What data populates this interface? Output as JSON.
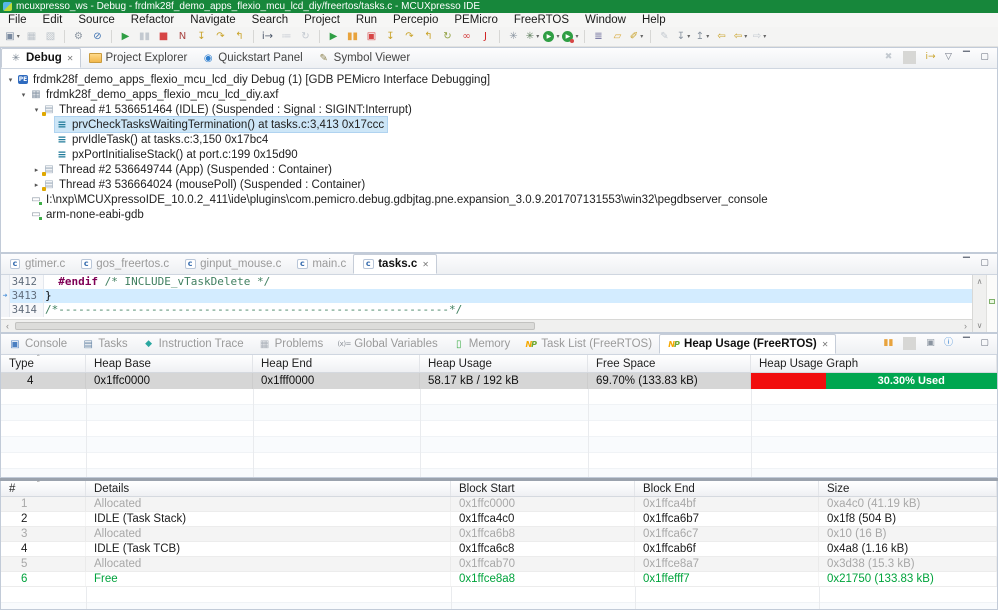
{
  "window": {
    "title": "mcuxpresso_ws - Debug - frdmk28f_demo_apps_flexio_mcu_lcd_diy/freertos/tasks.c - MCUXpresso IDE"
  },
  "colors": {
    "titlebar_green": "#17873b",
    "heap_used_red": "#f10e0e",
    "heap_free_green": "#00a650",
    "selection_blue": "#cde6f7",
    "current_line_blue": "#d3ecff"
  },
  "menu": {
    "items": [
      "File",
      "Edit",
      "Source",
      "Refactor",
      "Navigate",
      "Search",
      "Project",
      "Run",
      "Percepio",
      "PEMicro",
      "FreeRTOS",
      "Window",
      "Help"
    ]
  },
  "toolbar": {
    "icons": [
      {
        "name": "new-wizard-icon",
        "glyph": "▣",
        "color": "#7a8aa0",
        "dd": true
      },
      {
        "name": "save-icon",
        "glyph": "▦",
        "color": "#bcc3ca"
      },
      {
        "name": "save-all-icon",
        "glyph": "▧",
        "color": "#bcc3ca"
      },
      {
        "sep": true,
        "inter": false
      },
      {
        "name": "build-binary-icon",
        "glyph": "⚙",
        "color": "#8a94a0"
      },
      {
        "name": "skip-breakpoints-icon",
        "glyph": "⊘",
        "color": "#3a6fb0"
      },
      {
        "sep": true,
        "inter": false
      },
      {
        "name": "resume-icon",
        "glyph": "▶",
        "color": "#2f9e44"
      },
      {
        "name": "suspend-icon",
        "glyph": "▮▮",
        "color": "#c3c9d0"
      },
      {
        "name": "terminate-icon",
        "glyph": "■",
        "color": "#d64545"
      },
      {
        "name": "disconnect-icon",
        "glyph": "N",
        "color": "#a94442"
      },
      {
        "name": "step-into-icon",
        "glyph": "↧",
        "color": "#c9a227"
      },
      {
        "name": "step-over-icon",
        "glyph": "↷",
        "color": "#c9a227"
      },
      {
        "name": "step-return-icon",
        "glyph": "↰",
        "color": "#c9a227"
      },
      {
        "sep": true,
        "inter": false
      },
      {
        "name": "instruction-stepping-icon",
        "glyph": "i→",
        "color": "#4a5568"
      },
      {
        "name": "show-trace-icon",
        "glyph": "≔",
        "color": "#c3c9d0"
      },
      {
        "name": "trace-options-icon",
        "glyph": "↻",
        "color": "#c3c9d0"
      },
      {
        "sep": true,
        "inter": false
      },
      {
        "name": "resume-all-icon",
        "glyph": "▶",
        "color": "#2f9e44"
      },
      {
        "name": "suspend-all-icon",
        "glyph": "▮▮",
        "color": "#e8a33d"
      },
      {
        "name": "terminate-all-icon",
        "glyph": "▣",
        "color": "#d64545"
      },
      {
        "name": "multi-step-into-icon",
        "glyph": "↧",
        "color": "#c9a227"
      },
      {
        "name": "multi-step-over-icon",
        "glyph": "↷",
        "color": "#c9a227"
      },
      {
        "name": "multi-step-return-icon",
        "glyph": "↰",
        "color": "#c9a227"
      },
      {
        "name": "refresh-icon",
        "glyph": "↻",
        "color": "#8f9f3f"
      },
      {
        "name": "link-debug-icon",
        "glyph": "∞",
        "color": "#d64545"
      },
      {
        "name": "redlink-boot-icon",
        "glyph": "J",
        "color": "#cf1f1f"
      },
      {
        "sep": true,
        "inter": false
      },
      {
        "name": "flash-programmer-icon",
        "glyph": "✳",
        "color": "#8a94a0"
      },
      {
        "name": "debug-icon",
        "glyph": "✳",
        "color": "#5f7f5f",
        "dd": true
      },
      {
        "name": "run-icon",
        "glyph": "▶",
        "color": "#ffffff",
        "bg": "#2f9e44",
        "cls": "circle",
        "dd": true
      },
      {
        "name": "profile-icon",
        "glyph": "▶",
        "color": "#ffffff",
        "bg": "#2f9e44",
        "cls": "circle dot",
        "dd": true
      },
      {
        "sep": true,
        "inter": false
      },
      {
        "name": "library-icon",
        "glyph": "≣",
        "color": "#6f6f9e"
      },
      {
        "name": "open-resource-icon",
        "glyph": "▱",
        "color": "#d8a736"
      },
      {
        "name": "search-icon",
        "glyph": "✐",
        "color": "#c9a227",
        "dd": true
      },
      {
        "sep": true,
        "inter": false
      },
      {
        "name": "mark-occurrences-icon",
        "glyph": "✎",
        "color": "#c3c9d0"
      },
      {
        "name": "next-annotation-icon",
        "glyph": "↧",
        "color": "#8a94a0",
        "dd": true
      },
      {
        "name": "prev-annotation-icon",
        "glyph": "↥",
        "color": "#8a94a0",
        "dd": true
      },
      {
        "name": "last-edit-icon",
        "glyph": "⇦",
        "color": "#c9a227"
      },
      {
        "name": "back-icon",
        "glyph": "⇦",
        "color": "#c9a227",
        "dd": true
      },
      {
        "name": "forward-icon",
        "glyph": "⇨",
        "color": "#c3c9d0",
        "dd": true
      }
    ]
  },
  "debug_panel": {
    "tabs": [
      {
        "label": "Debug",
        "icon": "debug-view-icon",
        "cls": "active",
        "close": "✕"
      },
      {
        "label": "Project Explorer",
        "icon": "project-explorer-icon"
      },
      {
        "label": "Quickstart Panel",
        "icon": "quickstart-icon"
      },
      {
        "label": "Symbol Viewer",
        "icon": "symbol-viewer-icon"
      }
    ],
    "toolbar_icons": [
      {
        "name": "remove-terminated-icon",
        "glyph": "✖",
        "color": "#c3c9d0"
      },
      {
        "sep": true,
        "inter": false
      },
      {
        "name": "instruction-stepping-toggle-icon",
        "glyph": "i→",
        "color": "#c9a227"
      },
      {
        "name": "view-menu-icon",
        "glyph": "▽",
        "color": "#6b7280"
      },
      {
        "name": "minimize-icon",
        "glyph": "▔",
        "color": "#6b7280"
      },
      {
        "name": "maximize-icon",
        "glyph": "▢",
        "color": "#6b7280"
      }
    ],
    "tree": [
      {
        "cls": "lvl0",
        "exp": "▾",
        "icon": "pe-launch-icon",
        "label": "frdmk28f_demo_apps_flexio_mcu_lcd_diy Debug (1) [GDB PEMicro Interface Debugging]"
      },
      {
        "cls": "lvl1",
        "exp": "▾",
        "icon": "axf-file-icon",
        "label": "frdmk28f_demo_apps_flexio_mcu_lcd_diy.axf"
      },
      {
        "cls": "lvl2",
        "exp": "▾",
        "icon": "thread-icon",
        "label": "Thread #1 536651464 (IDLE) (Suspended : Signal : SIGINT:Interrupt)"
      },
      {
        "cls": "lvl3 selected",
        "exp": "",
        "icon": "stack-frame-icon",
        "label": "prvCheckTasksWaitingTermination() at tasks.c:3,413 0x17ccc"
      },
      {
        "cls": "lvl3",
        "exp": "",
        "icon": "stack-frame-icon",
        "label": "prvIdleTask() at tasks.c:3,150 0x17bc4"
      },
      {
        "cls": "lvl3",
        "exp": "",
        "icon": "stack-frame-icon",
        "label": "pxPortInitialiseStack() at port.c:199 0x15d90"
      },
      {
        "cls": "lvl2",
        "exp": "▸",
        "icon": "thread-icon",
        "label": "Thread #2 536649744 (App) (Suspended : Container)"
      },
      {
        "cls": "lvl2",
        "exp": "▸",
        "icon": "thread-icon",
        "label": "Thread #3 536664024 (mousePoll) (Suspended : Container)"
      },
      {
        "cls": "lvl1",
        "exp": "",
        "icon": "process-icon",
        "label": "I:\\nxp\\MCUXpressoIDE_10.0.2_411\\ide\\plugins\\com.pemicro.debug.gdbjtag.pne.expansion_3.0.9.201707131553\\win32\\pegdbserver_console"
      },
      {
        "cls": "lvl1",
        "exp": "",
        "icon": "process-icon",
        "label": "arm-none-eabi-gdb"
      }
    ]
  },
  "editor": {
    "tabs": [
      {
        "label": "gtimer.c",
        "icon": "c-file-icon",
        "cls": "gray"
      },
      {
        "label": "gos_freertos.c",
        "icon": "c-file-icon",
        "cls": "gray"
      },
      {
        "label": "ginput_mouse.c",
        "icon": "c-file-icon",
        "cls": "gray"
      },
      {
        "label": "main.c",
        "icon": "c-file-icon",
        "cls": "gray"
      },
      {
        "label": "tasks.c",
        "icon": "c-file-icon",
        "cls": "active",
        "close": "✕"
      }
    ],
    "toolbar_icons": [
      {
        "name": "minimize-icon",
        "glyph": "▔",
        "color": "#6b7280"
      },
      {
        "name": "maximize-icon",
        "glyph": "▢",
        "color": "#6b7280"
      }
    ],
    "lines": [
      {
        "num": "3412",
        "indent": "  ",
        "directive": "#endif",
        "mid": " ",
        "comment": "/* INCLUDE_vTaskDelete */"
      },
      {
        "num": "3413",
        "plain": "}"
      },
      {
        "num": "3414",
        "comment": "/*-----------------------------------------------------------*/"
      }
    ],
    "pointer_glyph": "➜"
  },
  "bottom_panel": {
    "tabs": [
      {
        "label": "Console",
        "icon": "console-icon",
        "cls": "gray"
      },
      {
        "label": "Tasks",
        "icon": "tasks-icon",
        "cls": "gray"
      },
      {
        "label": "Instruction Trace",
        "icon": "instruction-trace-icon",
        "cls": "gray"
      },
      {
        "label": "Problems",
        "icon": "problems-icon",
        "cls": "gray"
      },
      {
        "label": "Global Variables",
        "icon": "global-variables-icon",
        "cls": "gray"
      },
      {
        "label": "Memory",
        "icon": "memory-icon",
        "cls": "gray"
      },
      {
        "label": "Task List (FreeRTOS)",
        "icon": "nxp-icon",
        "cls": "gray"
      },
      {
        "label": "Heap Usage (FreeRTOS)",
        "icon": "nxp-icon",
        "cls": "active",
        "close": "✕"
      }
    ],
    "toolbar_icons": [
      {
        "name": "pause-updates-icon",
        "glyph": "▮▮",
        "color": "#e8a33d"
      },
      {
        "sep": true,
        "inter": false
      },
      {
        "name": "save-snapshot-icon",
        "glyph": "▣",
        "color": "#8a94a0"
      },
      {
        "name": "info-icon",
        "glyph": "ⓘ",
        "color": "#2f7fd0"
      },
      {
        "name": "minimize-icon",
        "glyph": "▔",
        "color": "#6b7280"
      },
      {
        "name": "maximize-icon",
        "glyph": "▢",
        "color": "#6b7280"
      }
    ],
    "heap_table": {
      "columns": [
        "Type",
        "Heap Base",
        "Heap End",
        "Heap Usage",
        "Free Space",
        "Heap Usage Graph"
      ],
      "sort_indicator": "ˆ",
      "row": {
        "type": "4",
        "base": "0x1ffc0000",
        "end": "0x1fff0000",
        "usage": "58.17 kB / 192 kB",
        "free": "69.70% (133.83 kB)",
        "graph_label": "30.30% Used",
        "used_pct": 30.3,
        "free_pct": 69.7
      }
    }
  },
  "block_table": {
    "columns": [
      "#",
      "Details",
      "Block Start",
      "Block End",
      "Size"
    ],
    "sort_indicator": "ˆ",
    "rows": [
      {
        "num": "1",
        "details": "Allocated",
        "start": "0x1ffc0000",
        "end": "0x1ffca4bf",
        "size": "0xa4c0 (41.19 kB)",
        "state": "allocated"
      },
      {
        "num": "2",
        "details": "IDLE (Task Stack)",
        "start": "0x1ffca4c0",
        "end": "0x1ffca6b7",
        "size": "0x1f8 (504 B)",
        "state": "named"
      },
      {
        "num": "3",
        "details": "Allocated",
        "start": "0x1ffca6b8",
        "end": "0x1ffca6c7",
        "size": "0x10 (16 B)",
        "state": "allocated"
      },
      {
        "num": "4",
        "details": "IDLE (Task TCB)",
        "start": "0x1ffca6c8",
        "end": "0x1ffcab6f",
        "size": "0x4a8 (1.16 kB)",
        "state": "named"
      },
      {
        "num": "5",
        "details": "Allocated",
        "start": "0x1ffcab70",
        "end": "0x1ffce8a7",
        "size": "0x3d38 (15.3 kB)",
        "state": "allocated"
      },
      {
        "num": "6",
        "details": "Free",
        "start": "0x1ffce8a8",
        "end": "0x1ffefff7",
        "size": "0x21750 (133.83 kB)",
        "state": "free"
      }
    ]
  },
  "scrollbar": {
    "left_arrow": "‹",
    "right_arrow": "›",
    "up_arrow": "∧",
    "down_arrow": "∨"
  }
}
